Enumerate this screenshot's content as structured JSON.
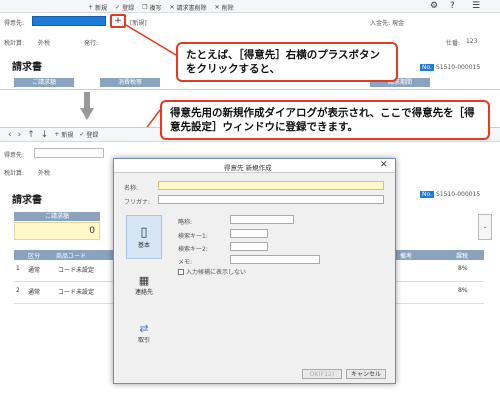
{
  "top": {
    "toolbar": {
      "new": "新規",
      "register": "登録",
      "copy": "複写",
      "delete_invoice": "請求書削除",
      "delete": "削除"
    },
    "customer_label": "得意先:",
    "new_marker": "[新規]",
    "payment_label": "入金先:",
    "payment_value": "現金",
    "tax_label": "税計算:",
    "tax_value": "外税",
    "issue_label": "発行:",
    "stock_label": "仕番:",
    "stock_value": "123",
    "title": "請求書",
    "hdr1": "ご請求額",
    "hdr2": "消費税等",
    "hdr3": "請求期間",
    "no_label": "No.",
    "no_value": "S1510-000015"
  },
  "bubble1": "たとえば、［得意先］右横のプラスボタンをクリックすると、",
  "bubble2": "得意先用の新規作成ダイアログが表示され、ここで得意先を［得意先設定］ウィンドウに登録できます。",
  "bottom": {
    "toolbar": {
      "new": "新規",
      "register": "登録"
    },
    "customer_label": "得意先:",
    "tax_label": "税計算:",
    "tax_value": "外税",
    "title": "請求書",
    "hdr1": "ご請求額",
    "amount": "0",
    "no_label": "No.",
    "no_value": "S1510-000015",
    "cols": {
      "section": "区分",
      "code": "商品コード",
      "note": "備考",
      "tax": "課税"
    },
    "rows": [
      {
        "num": "1",
        "section": "通常",
        "code": "コード未設定",
        "tax": "8%"
      },
      {
        "num": "2",
        "section": "通常",
        "code": "コード未設定",
        "tax": "8%"
      }
    ]
  },
  "dialog": {
    "title": "得意先 新規作成",
    "name_label": "名称:",
    "kana_label": "フリガナ:",
    "tabs": {
      "basic": "基本",
      "contact": "連絡先",
      "trade": "取引"
    },
    "short_label": "略称:",
    "key1_label": "検索キー1:",
    "key2_label": "検索キー2:",
    "memo_label": "メモ:",
    "hide_label": "入力候補に表示しない",
    "ok": "OK(F12)",
    "cancel": "キャンセル"
  },
  "colors": {
    "accent": "#e53922",
    "header": "#8aa3bf",
    "selected": "#1e7bd7"
  }
}
